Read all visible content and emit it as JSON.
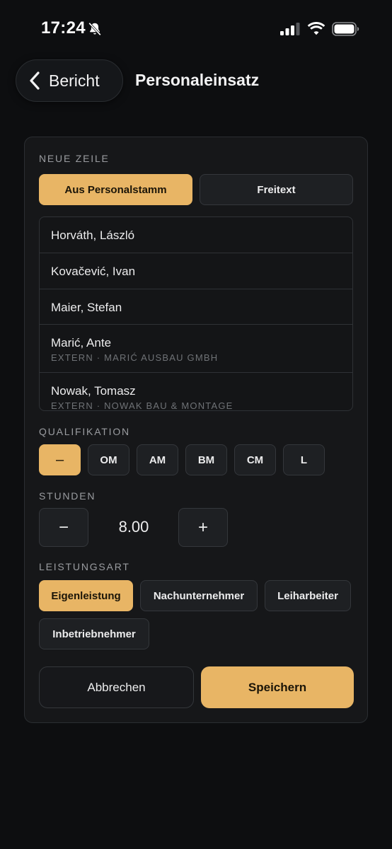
{
  "status_bar": {
    "time": "17:24",
    "icons": [
      "bell-slash-icon",
      "signal-icon",
      "wifi-icon",
      "battery-icon"
    ]
  },
  "nav": {
    "back_label": "Bericht",
    "back_icon": "chevron-left-icon",
    "title": "Personaleinsatz"
  },
  "form": {
    "new_row_label": "NEUE ZEILE",
    "source_tabs": [
      {
        "label": "Aus Personalstamm",
        "active": true
      },
      {
        "label": "Freitext",
        "active": false
      }
    ],
    "persons": [
      {
        "name": "Horváth, László",
        "sub": ""
      },
      {
        "name": "Kovačević, Ivan",
        "sub": ""
      },
      {
        "name": "Maier, Stefan",
        "sub": ""
      },
      {
        "name": "Marić, Ante",
        "sub": "EXTERN · MARIĆ AUSBAU GMBH"
      },
      {
        "name": "Nowak, Tomasz",
        "sub": "EXTERN · NOWAK BAU & MONTAGE"
      }
    ],
    "qualification_label": "QUALIFIKATION",
    "qualifications": [
      {
        "label": "–",
        "active": true
      },
      {
        "label": "OM",
        "active": false
      },
      {
        "label": "AM",
        "active": false
      },
      {
        "label": "BM",
        "active": false
      },
      {
        "label": "CM",
        "active": false
      },
      {
        "label": "L",
        "active": false
      }
    ],
    "hours_label": "STUNDEN",
    "hours_minus": "−",
    "hours_value": "8.00",
    "hours_plus": "+",
    "service_type_label": "LEISTUNGSART",
    "service_types": [
      {
        "label": "Eigenleistung",
        "active": true
      },
      {
        "label": "Nachunternehmer",
        "active": false
      },
      {
        "label": "Leiharbeiter",
        "active": false
      },
      {
        "label": "Inbetriebnehmer",
        "active": false
      }
    ],
    "cancel_label": "Abbrechen",
    "save_label": "Speichern"
  },
  "colors": {
    "accent": "#e8b565",
    "background": "#0d0e10",
    "card": "#161719"
  }
}
